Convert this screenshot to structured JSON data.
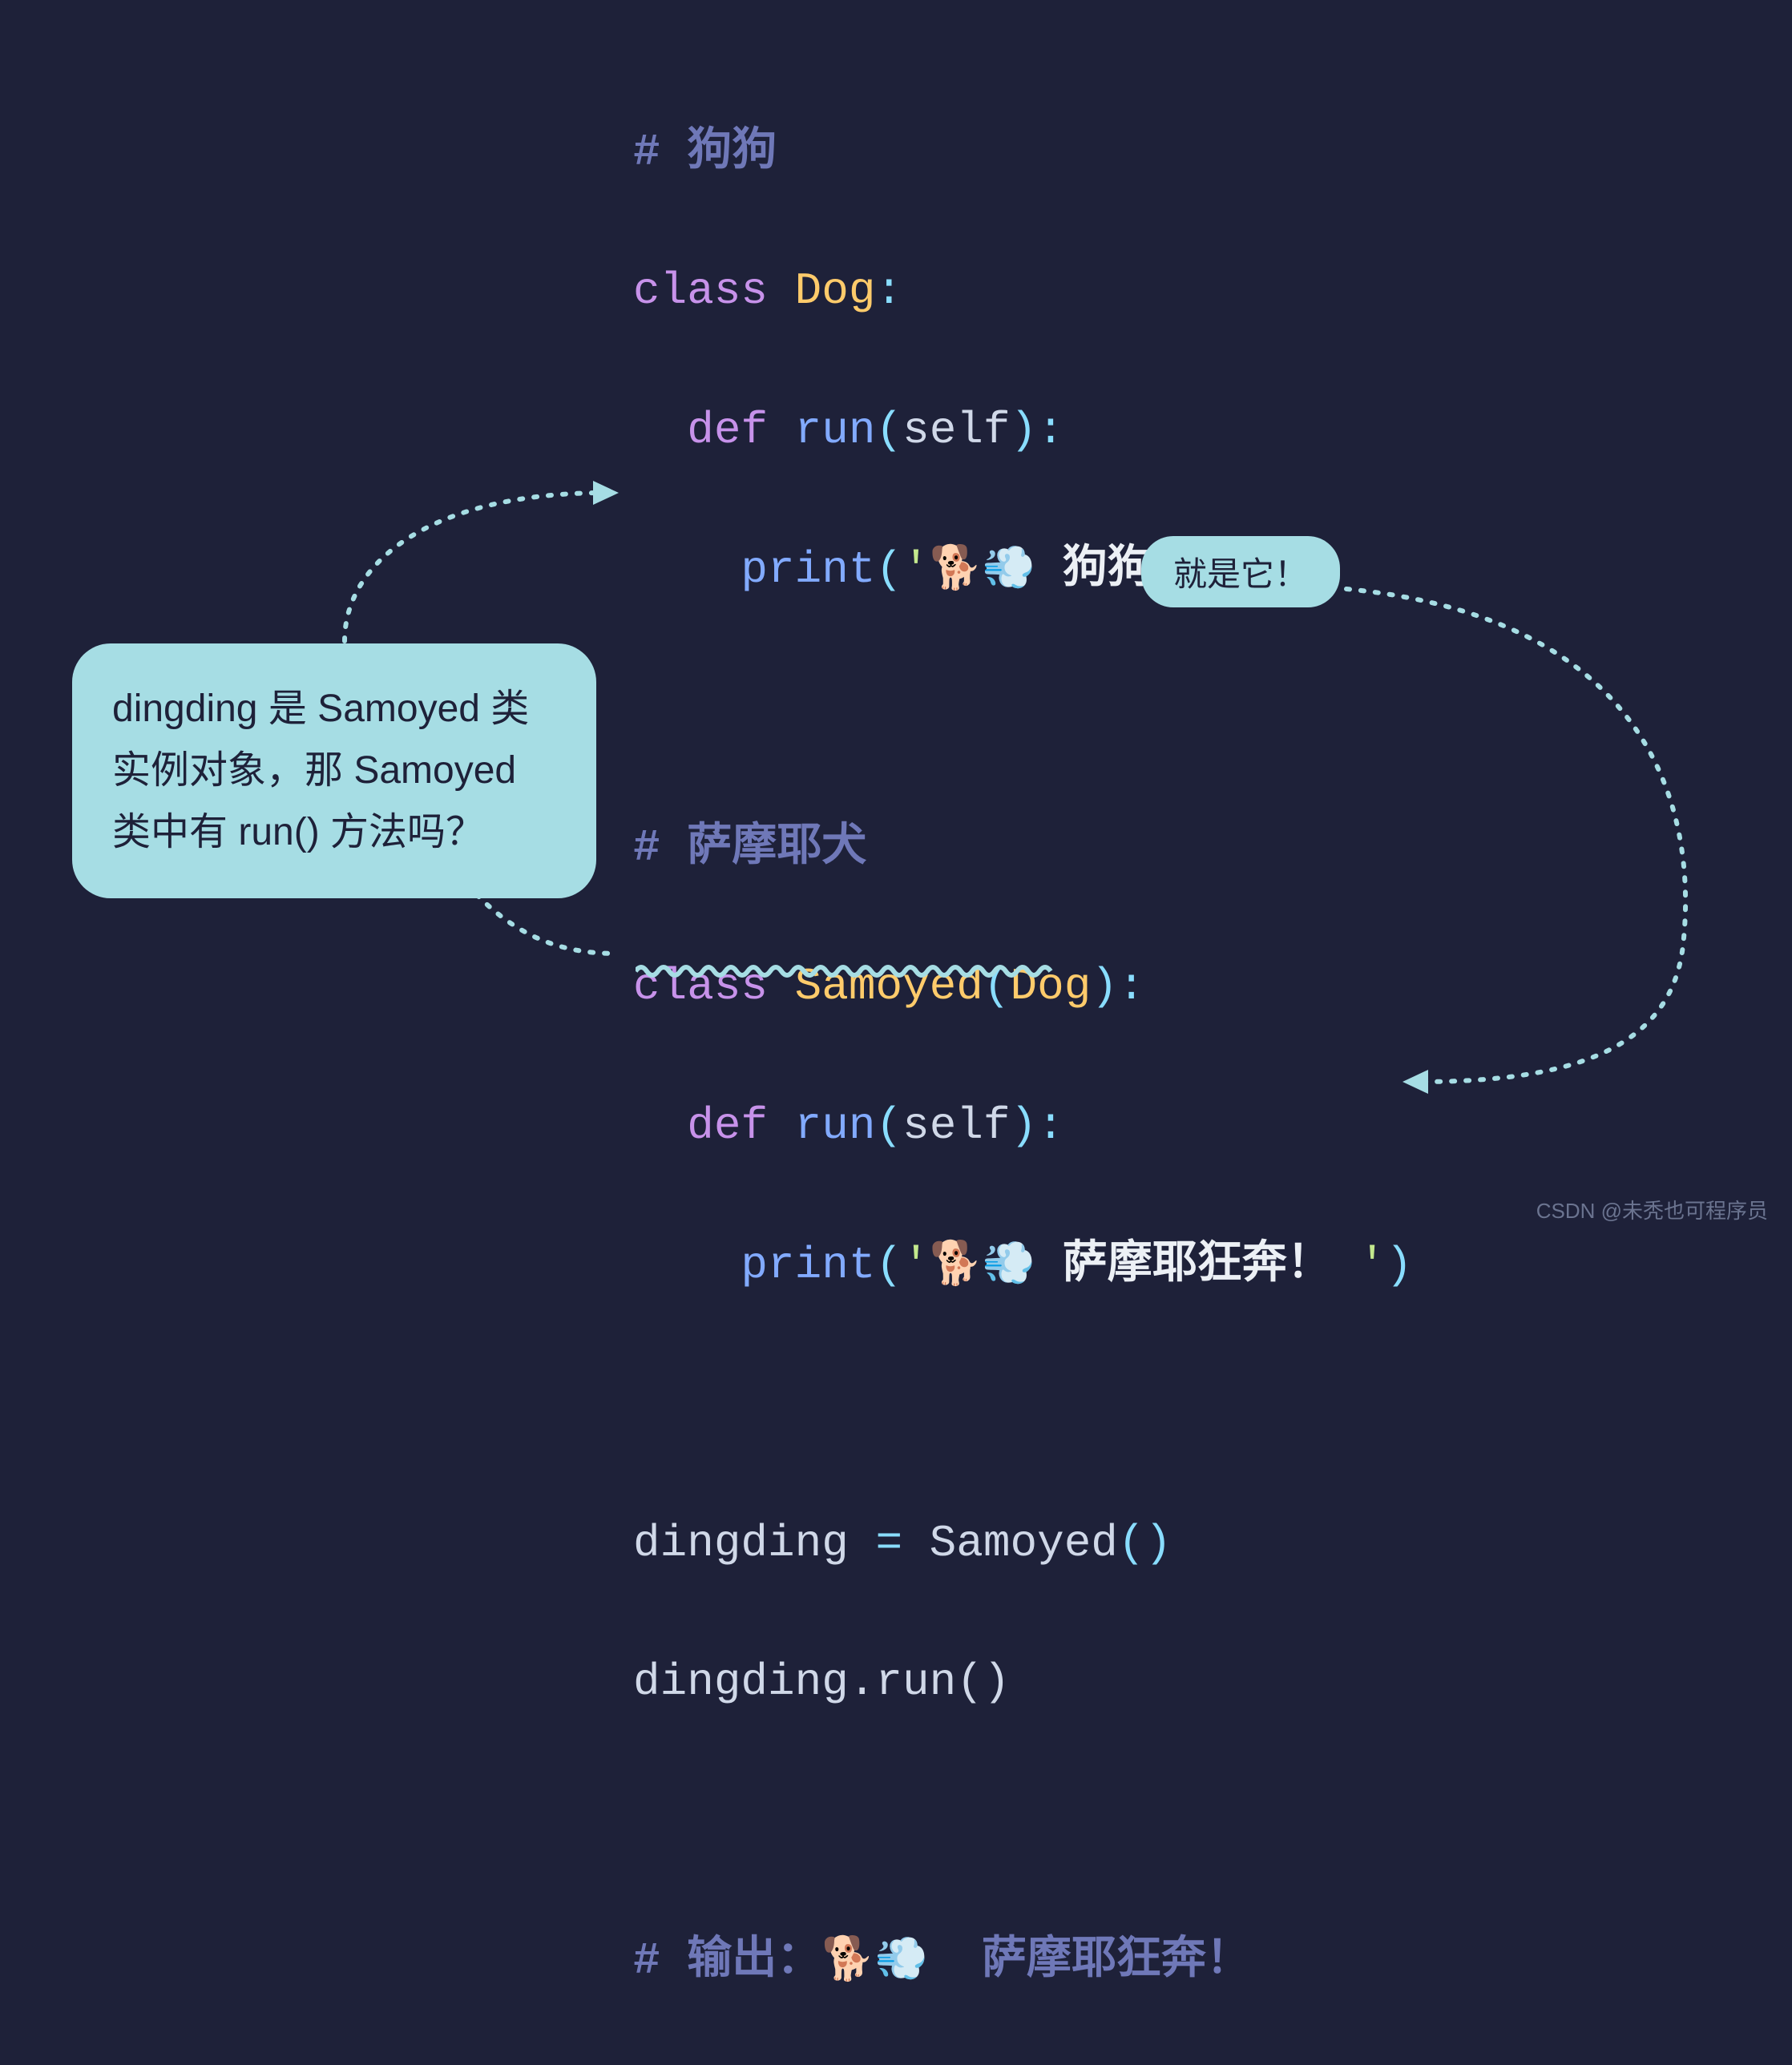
{
  "code": {
    "l1_comment": "# 狗狗",
    "l2_class": "class",
    "l2_name": "Dog",
    "l2_colon": ":",
    "l3_def": "def",
    "l3_fn": "run",
    "l3_open": "(",
    "l3_self": "self",
    "l3_close": "):",
    "l4_print": "print",
    "l4_open": "(",
    "l4_q1": "'",
    "l4_emoji": "🐕💨",
    "l4_text": " 狗狗快跑",
    "l4_q2": "'",
    "l4_close": ")",
    "l6_comment": "# 萨摩耶犬",
    "l7_class": "class",
    "l7_name": "Samoyed",
    "l7_open": "(",
    "l7_base": "Dog",
    "l7_close": "):",
    "l8_def": "def",
    "l8_fn": "run",
    "l8_open": "(",
    "l8_self": "self",
    "l8_close": "):",
    "l9_print": "print",
    "l9_open": "(",
    "l9_q1": "'",
    "l9_emoji": "🐕💨",
    "l9_text": " 萨摩耶狂奔！ ",
    "l9_q2": "'",
    "l9_close": ")",
    "l11_a": "dingding ",
    "l11_eq": "=",
    "l11_b": " Samoyed",
    "l11_paren": "()",
    "l12": "dingding.run()",
    "l14_comment_a": "# 输出：",
    "l14_emoji": "🐕💨",
    "l14_comment_b": "  萨摩耶狂奔！"
  },
  "callout_text": "dingding 是 Samoyed 类实例对象，那 Samoyed 类中有 run() 方法吗？",
  "badge_text": "就是它！",
  "watermark": "CSDN @未秃也可程序员",
  "colors": {
    "bg": "#1e2139",
    "accent": "#a6dde4",
    "comment": "#6f78b8",
    "keyword": "#c792ea",
    "class": "#ffcb6b",
    "func": "#82aaff"
  }
}
